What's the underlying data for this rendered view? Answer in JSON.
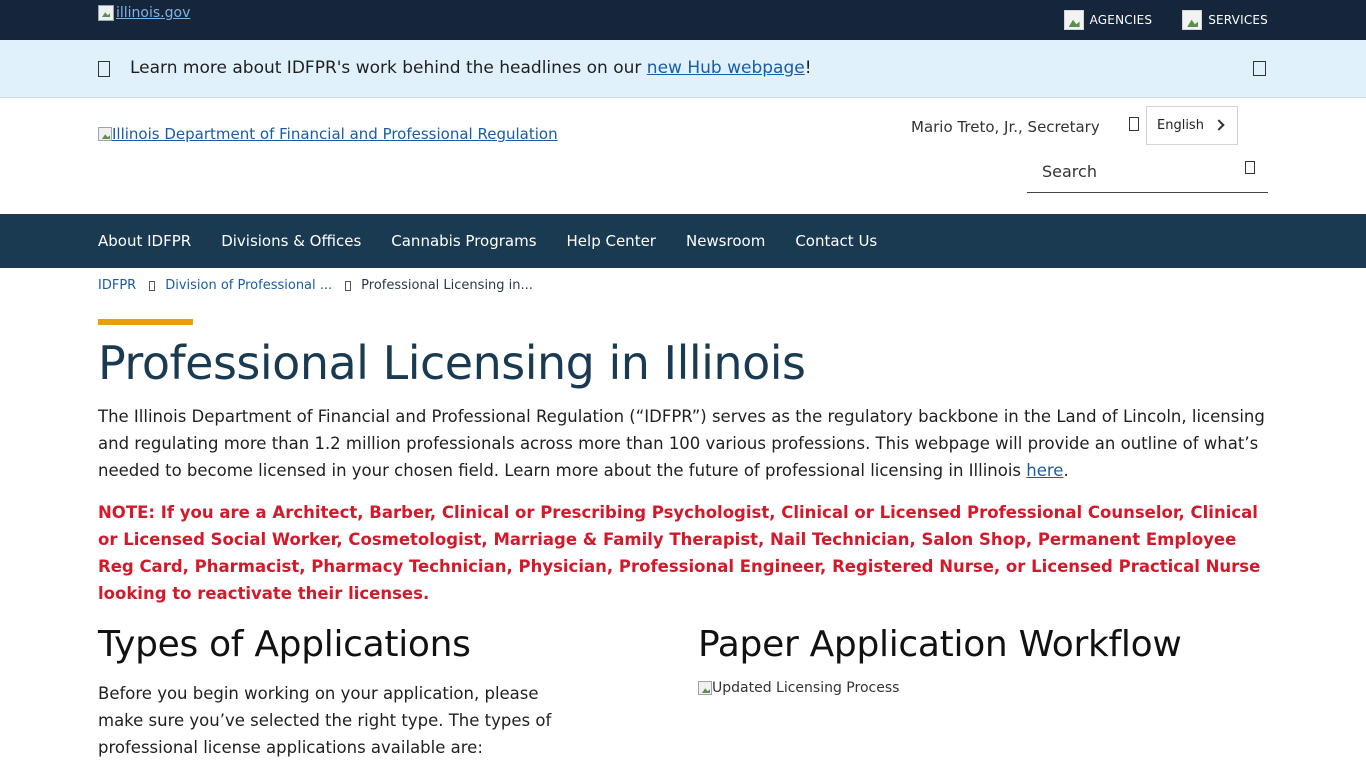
{
  "topbar": {
    "logo_alt": "illinois.gov",
    "links": [
      {
        "label": "AGENCIES"
      },
      {
        "label": "SERVICES"
      }
    ]
  },
  "announcement": {
    "text_before": "Learn more about IDFPR's work behind the headlines on our ",
    "link_text": "new Hub webpage",
    "text_after": "!"
  },
  "header": {
    "logo_alt": "Illinois Department of Financial and Professional Regulation",
    "secretary": "Mario Treto, Jr., Secretary",
    "language": "English",
    "search_placeholder": "Search"
  },
  "nav": {
    "items": [
      {
        "label": "About IDFPR"
      },
      {
        "label": "Divisions & Offices"
      },
      {
        "label": "Cannabis Programs"
      },
      {
        "label": "Help Center"
      },
      {
        "label": "Newsroom"
      },
      {
        "label": "Contact Us"
      }
    ]
  },
  "breadcrumb": [
    {
      "label": "IDFPR"
    },
    {
      "label": "Division of Professional ..."
    },
    {
      "label": "Professional Licensing in..."
    }
  ],
  "page": {
    "title": "Professional Licensing in Illinois",
    "intro_before": "The Illinois Department of Financial and Professional Regulation (“IDFPR”) serves as the regulatory backbone in the Land of Lincoln, licensing and regulating more than 1.2 million professionals across more than 100 various professions. This webpage will provide an outline of what’s needed to become licensed in your chosen field. Learn more about the future of professional licensing in Illinois ",
    "intro_link": "here",
    "intro_after": ".",
    "note": "NOTE: If you are a Architect, Barber, Clinical or Prescribing Psychologist, Clinical or Licensed Professional Counselor, Clinical or Licensed Social Worker, Cosmetologist, Marriage & Family Therapist, Nail Technician, Salon Shop, Permanent Employee Reg Card, Pharmacist, Pharmacy Technician, Physician, Professional Engineer, Registered Nurse, or Licensed Practical Nurse looking to reactivate their licenses.",
    "types_heading": "Types of Applications",
    "types_text": "Before you begin working on your application, please make sure you’ve selected the right type. The types of professional license applications available are:",
    "workflow_heading": "Paper Application Workflow",
    "workflow_img_alt": "Updated Licensing Process"
  }
}
